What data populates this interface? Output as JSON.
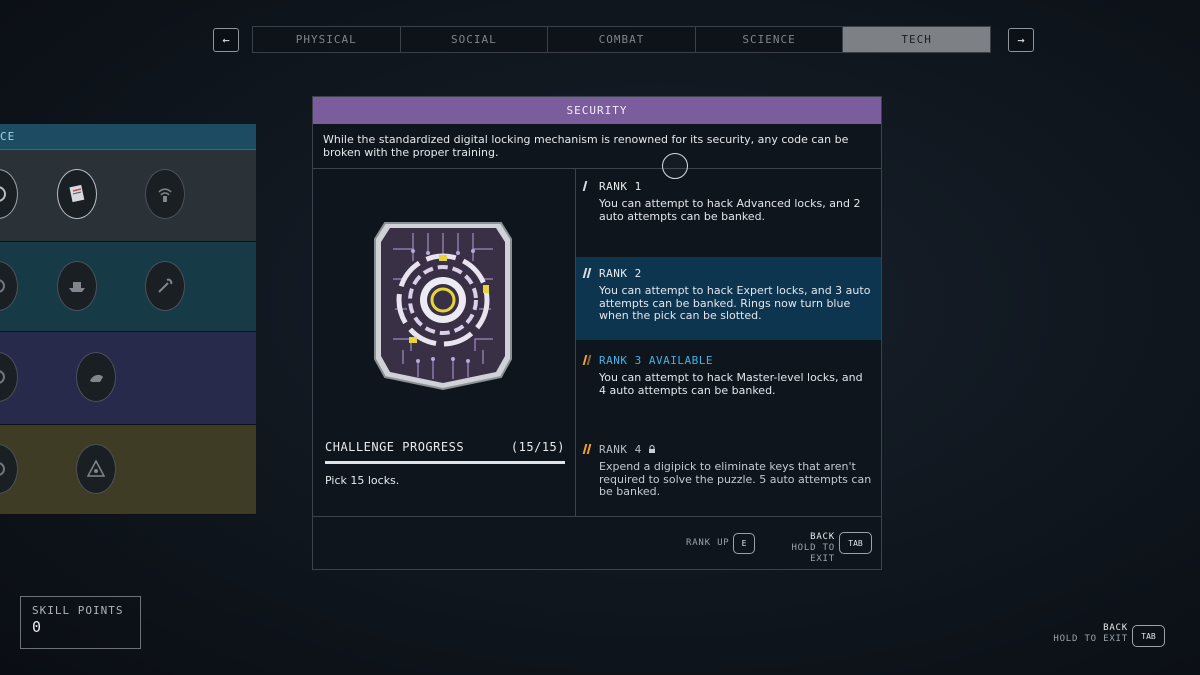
{
  "nav": {
    "prev_arrow": "←",
    "next_arrow": "→",
    "tabs": [
      {
        "label": "PHYSICAL",
        "active": false
      },
      {
        "label": "SOCIAL",
        "active": false
      },
      {
        "label": "COMBAT",
        "active": false
      },
      {
        "label": "SCIENCE",
        "active": false
      },
      {
        "label": "TECH",
        "active": true
      }
    ]
  },
  "skill_tree": {
    "header_label": "CE",
    "tier_colors": [
      "#2a3238",
      "#173a47",
      "#282a4c",
      "#3f3c25"
    ]
  },
  "dialog": {
    "title": "SECURITY",
    "title_color": "#7b5c9c",
    "description": "While the standardized digital locking mechanism is renowned for its security, any code can be broken with the proper training.",
    "challenge": {
      "label": "CHALLENGE PROGRESS",
      "count": "(15/15)",
      "progress": 1.0,
      "text": "Pick 15 locks."
    },
    "ranks": [
      {
        "label": "RANK 1",
        "description": "You can attempt to hack Advanced locks, and 2 auto attempts can be banked.",
        "state": "unlocked"
      },
      {
        "label": "RANK 2",
        "description": "You can attempt to hack Expert locks, and 3 auto attempts can be banked. Rings now turn blue when the pick can be slotted.",
        "state": "selected"
      },
      {
        "label": "RANK 3 AVAILABLE",
        "description": "You can attempt to hack Master-level locks, and 4 auto attempts can be banked.",
        "state": "available"
      },
      {
        "label": "RANK 4",
        "description": "Expend a digipick to eliminate keys that aren't required to solve the puzzle. 5 auto attempts can be banked.",
        "state": "locked"
      }
    ],
    "footer": {
      "rank_up_label": "RANK UP",
      "rank_up_key": "E",
      "back_label": "BACK",
      "hold_label": "HOLD TO EXIT",
      "back_key": "TAB"
    }
  },
  "skill_points": {
    "label": "SKILL POINTS",
    "value": "0"
  },
  "global_footer": {
    "back_label": "BACK",
    "hold_label": "HOLD TO EXIT",
    "back_key": "TAB"
  },
  "colors": {
    "accent_blue": "#3fb3e6",
    "rank_available": "#f0a030",
    "highlight_row": "#0d3550"
  }
}
